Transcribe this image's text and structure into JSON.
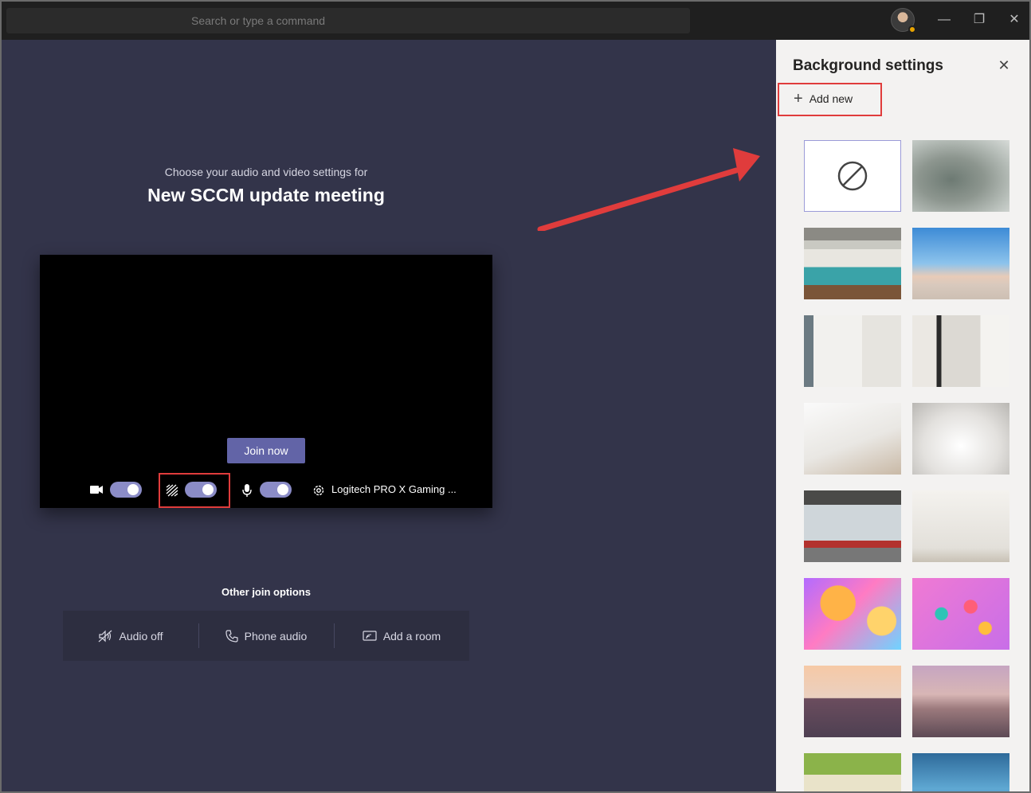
{
  "search": {
    "placeholder": "Search or type a command"
  },
  "window": {
    "minimize": "—",
    "maximize": "❐",
    "close": "✕"
  },
  "prejoin": {
    "subtitle": "Choose your audio and video settings for",
    "meeting_title": "New SCCM update meeting",
    "join_label": "Join now",
    "device_label": "Logitech PRO X Gaming ...",
    "toggles": {
      "camera": true,
      "background": true,
      "microphone": true
    }
  },
  "other_options": {
    "label": "Other join options",
    "items": [
      {
        "label": "Audio off",
        "icon": "speaker-muted-icon"
      },
      {
        "label": "Phone audio",
        "icon": "phone-icon"
      },
      {
        "label": "Add a room",
        "icon": "room-cast-icon"
      }
    ]
  },
  "panel": {
    "title": "Background settings",
    "add_new": "Add new",
    "backgrounds": [
      "none",
      "blur",
      "office-lockers",
      "beach-lifeguard",
      "white-room-window",
      "white-room-doorway",
      "white-loft",
      "white-studio",
      "industrial-loft",
      "plain-room",
      "colorful-balloons",
      "confetti-balls",
      "golden-gate-illustration",
      "canyon-illustration",
      "game-room",
      "arcade-room"
    ]
  },
  "colors": {
    "accent": "#6264a7",
    "annotation": "#e03c3c",
    "stage": "#33344a"
  }
}
